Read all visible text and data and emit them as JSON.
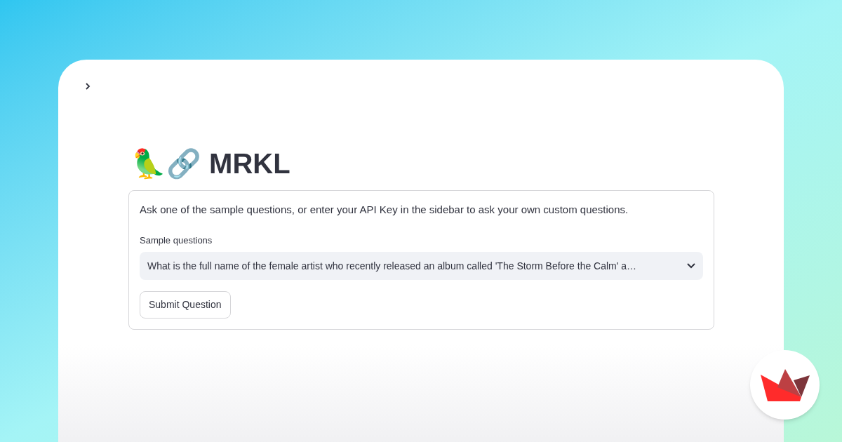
{
  "sidebar_toggle": {
    "expanded": false
  },
  "title": "🦜🔗 MRKL",
  "info": "Ask one of the sample questions, or enter your API Key in the sidebar to ask your own custom questions.",
  "select": {
    "label": "Sample questions",
    "value": "What is the full name of the female artist who recently released an album called 'The Storm Before the Calm' a…"
  },
  "button": "Submit Question"
}
